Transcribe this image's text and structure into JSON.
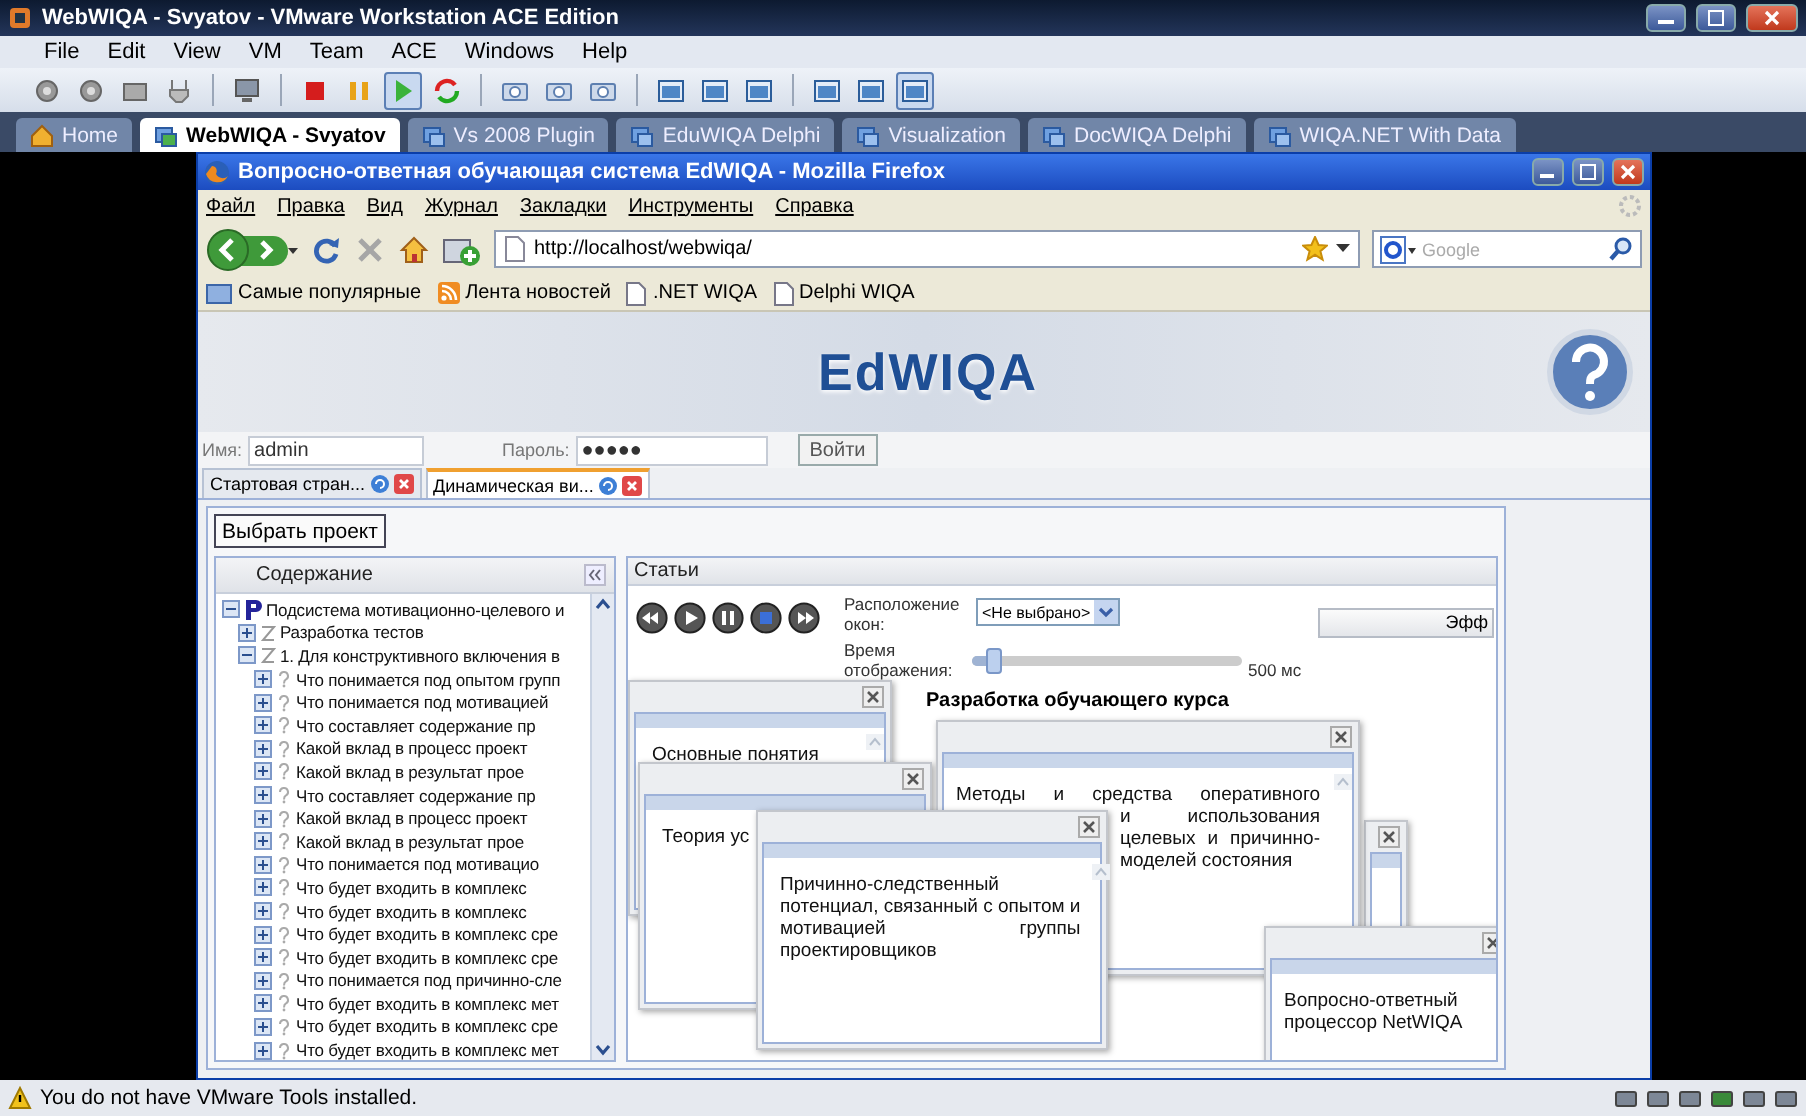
{
  "vm": {
    "title": "WebWIQA - Svyatov - VMware Workstation ACE Edition",
    "menu": [
      "File",
      "Edit",
      "View",
      "VM",
      "Team",
      "ACE",
      "Windows",
      "Help"
    ],
    "toolbar": [
      {
        "kind": "gear",
        "pressed": false
      },
      {
        "kind": "gear",
        "pressed": false
      },
      {
        "kind": "drive",
        "pressed": false
      },
      {
        "kind": "plug",
        "pressed": false
      },
      {
        "kind": "separator"
      },
      {
        "kind": "console",
        "pressed": false
      },
      {
        "kind": "separator"
      },
      {
        "kind": "stop",
        "pressed": false
      },
      {
        "kind": "pause",
        "pressed": false
      },
      {
        "kind": "play",
        "pressed": true
      },
      {
        "kind": "reset",
        "pressed": false
      },
      {
        "kind": "separator"
      },
      {
        "kind": "camera",
        "pressed": false
      },
      {
        "kind": "camera",
        "pressed": false
      },
      {
        "kind": "camera",
        "pressed": false
      },
      {
        "kind": "separator"
      },
      {
        "kind": "panel",
        "pressed": false
      },
      {
        "kind": "panel",
        "pressed": false
      },
      {
        "kind": "panel",
        "pressed": false
      },
      {
        "kind": "separator"
      },
      {
        "kind": "panel",
        "pressed": false
      },
      {
        "kind": "panel",
        "pressed": false
      },
      {
        "kind": "panel",
        "pressed": true
      }
    ],
    "tabs": [
      {
        "label": "Home",
        "kind": "home",
        "selected": false
      },
      {
        "label": "WebWIQA - Svyatov",
        "kind": "vm",
        "selected": true
      },
      {
        "label": "Vs 2008 Plugin",
        "kind": "vm",
        "selected": false
      },
      {
        "label": "EduWIQA Delphi",
        "kind": "vm",
        "selected": false
      },
      {
        "label": "Visualization",
        "kind": "vm",
        "selected": false
      },
      {
        "label": "DocWIQA Delphi",
        "kind": "vm",
        "selected": false
      },
      {
        "label": "WIQA.NET With Data",
        "kind": "vm",
        "selected": false
      }
    ],
    "status": "You do not have VMware Tools installed."
  },
  "firefox": {
    "title": "Вопросно-ответная обучающая система EdWIQA - Mozilla Firefox",
    "menu": [
      "Файл",
      "Правка",
      "Вид",
      "Журнал",
      "Закладки",
      "Инструменты",
      "Справка"
    ],
    "url": "http://localhost/webwiqa/",
    "search": {
      "placeholder": "Google"
    },
    "bookmarks": [
      {
        "label": "Самые популярные",
        "kind": "smart"
      },
      {
        "label": "Лента новостей",
        "kind": "feed"
      },
      {
        "label": ".NET WIQA",
        "kind": "page"
      },
      {
        "label": "Delphi WIQA",
        "kind": "page"
      }
    ]
  },
  "page": {
    "logo": "EdWIQA",
    "login": {
      "name_label": "Имя:",
      "name_value": "admin",
      "password_label": "Пароль:",
      "password_value": "●●●●●",
      "submit": "Войти"
    },
    "tabs": [
      {
        "label": "Стартовая стран...",
        "selected": false
      },
      {
        "label": "Динамическая ви...",
        "selected": true
      }
    ],
    "choose_project": "Выбрать проект",
    "contents": {
      "title": "Содержание",
      "tree": [
        {
          "label": "Подсистема мотивационно-целевого и",
          "kind": "project",
          "expanded": true,
          "children": [
            {
              "label": "Разработка тестов",
              "kind": "section",
              "expanded": false
            },
            {
              "label": "1. Для конструктивного включения в",
              "kind": "section",
              "expanded": true,
              "children": [
                {
                  "label": "Что понимается под опытом групп",
                  "kind": "question",
                  "expanded": false
                },
                {
                  "label": "Что понимается под мотивацией",
                  "kind": "question",
                  "expanded": false
                },
                {
                  "label": "Что составляет содержание пр",
                  "kind": "question",
                  "expanded": false
                },
                {
                  "label": "Какой вклад в процесс проект",
                  "kind": "question",
                  "expanded": false
                },
                {
                  "label": "Какой вклад в результат прое",
                  "kind": "question",
                  "expanded": false
                },
                {
                  "label": "Что составляет содержание пр",
                  "kind": "question",
                  "expanded": false
                },
                {
                  "label": "Какой вклад в процесс проект",
                  "kind": "question",
                  "expanded": false
                },
                {
                  "label": "Какой вклад в результат прое",
                  "kind": "question",
                  "expanded": false
                },
                {
                  "label": "Что понимается под мотивацио",
                  "kind": "question",
                  "expanded": false
                },
                {
                  "label": "Что будет входить в комплекс",
                  "kind": "question",
                  "expanded": false
                },
                {
                  "label": "Что будет входить в комплекс",
                  "kind": "question",
                  "expanded": false
                },
                {
                  "label": "Что будет входить в комплекс сре",
                  "kind": "question",
                  "expanded": false
                },
                {
                  "label": "Что будет входить в комплекс сре",
                  "kind": "question",
                  "expanded": false
                },
                {
                  "label": "Что понимается под причинно-сле",
                  "kind": "question",
                  "expanded": false
                },
                {
                  "label": "Что будет входить в комплекс мет",
                  "kind": "question",
                  "expanded": false
                },
                {
                  "label": "Что будет входить в комплекс сре",
                  "kind": "question",
                  "expanded": false
                },
                {
                  "label": "Что будет входить в комплекс мет",
                  "kind": "question",
                  "expanded": false
                }
              ]
            }
          ]
        }
      ]
    },
    "articles": {
      "title": "Статьи",
      "layout_label": "Расположение окон:",
      "layout_value": "<Не выбрано>",
      "time_label": "Время отображения:",
      "time_slider": {
        "level": 0.08
      },
      "time_reading": "500 мс",
      "effects_button": "Эфф",
      "heading": "Разработка обучающего курса",
      "windows": [
        {
          "kind": "text",
          "lines": [
            "Основные понятия"
          ]
        },
        {
          "kind": "text",
          "lines": [
            "Теория ус"
          ]
        },
        {
          "kind": "split",
          "lines": [
            "Методы и средства оперативного",
            "и использования",
            "целевых и причинно-",
            "моделей состояния"
          ]
        },
        {
          "kind": "blank"
        },
        {
          "kind": "text",
          "lines": [
            "Причинно-следственный",
            "потенциал, связанный с опытом и",
            "мотивацией группы",
            "проектировщиков"
          ]
        },
        {
          "kind": "text",
          "lines": [
            "Вопросно-ответный",
            "процессор NetWIQA"
          ]
        }
      ]
    }
  }
}
